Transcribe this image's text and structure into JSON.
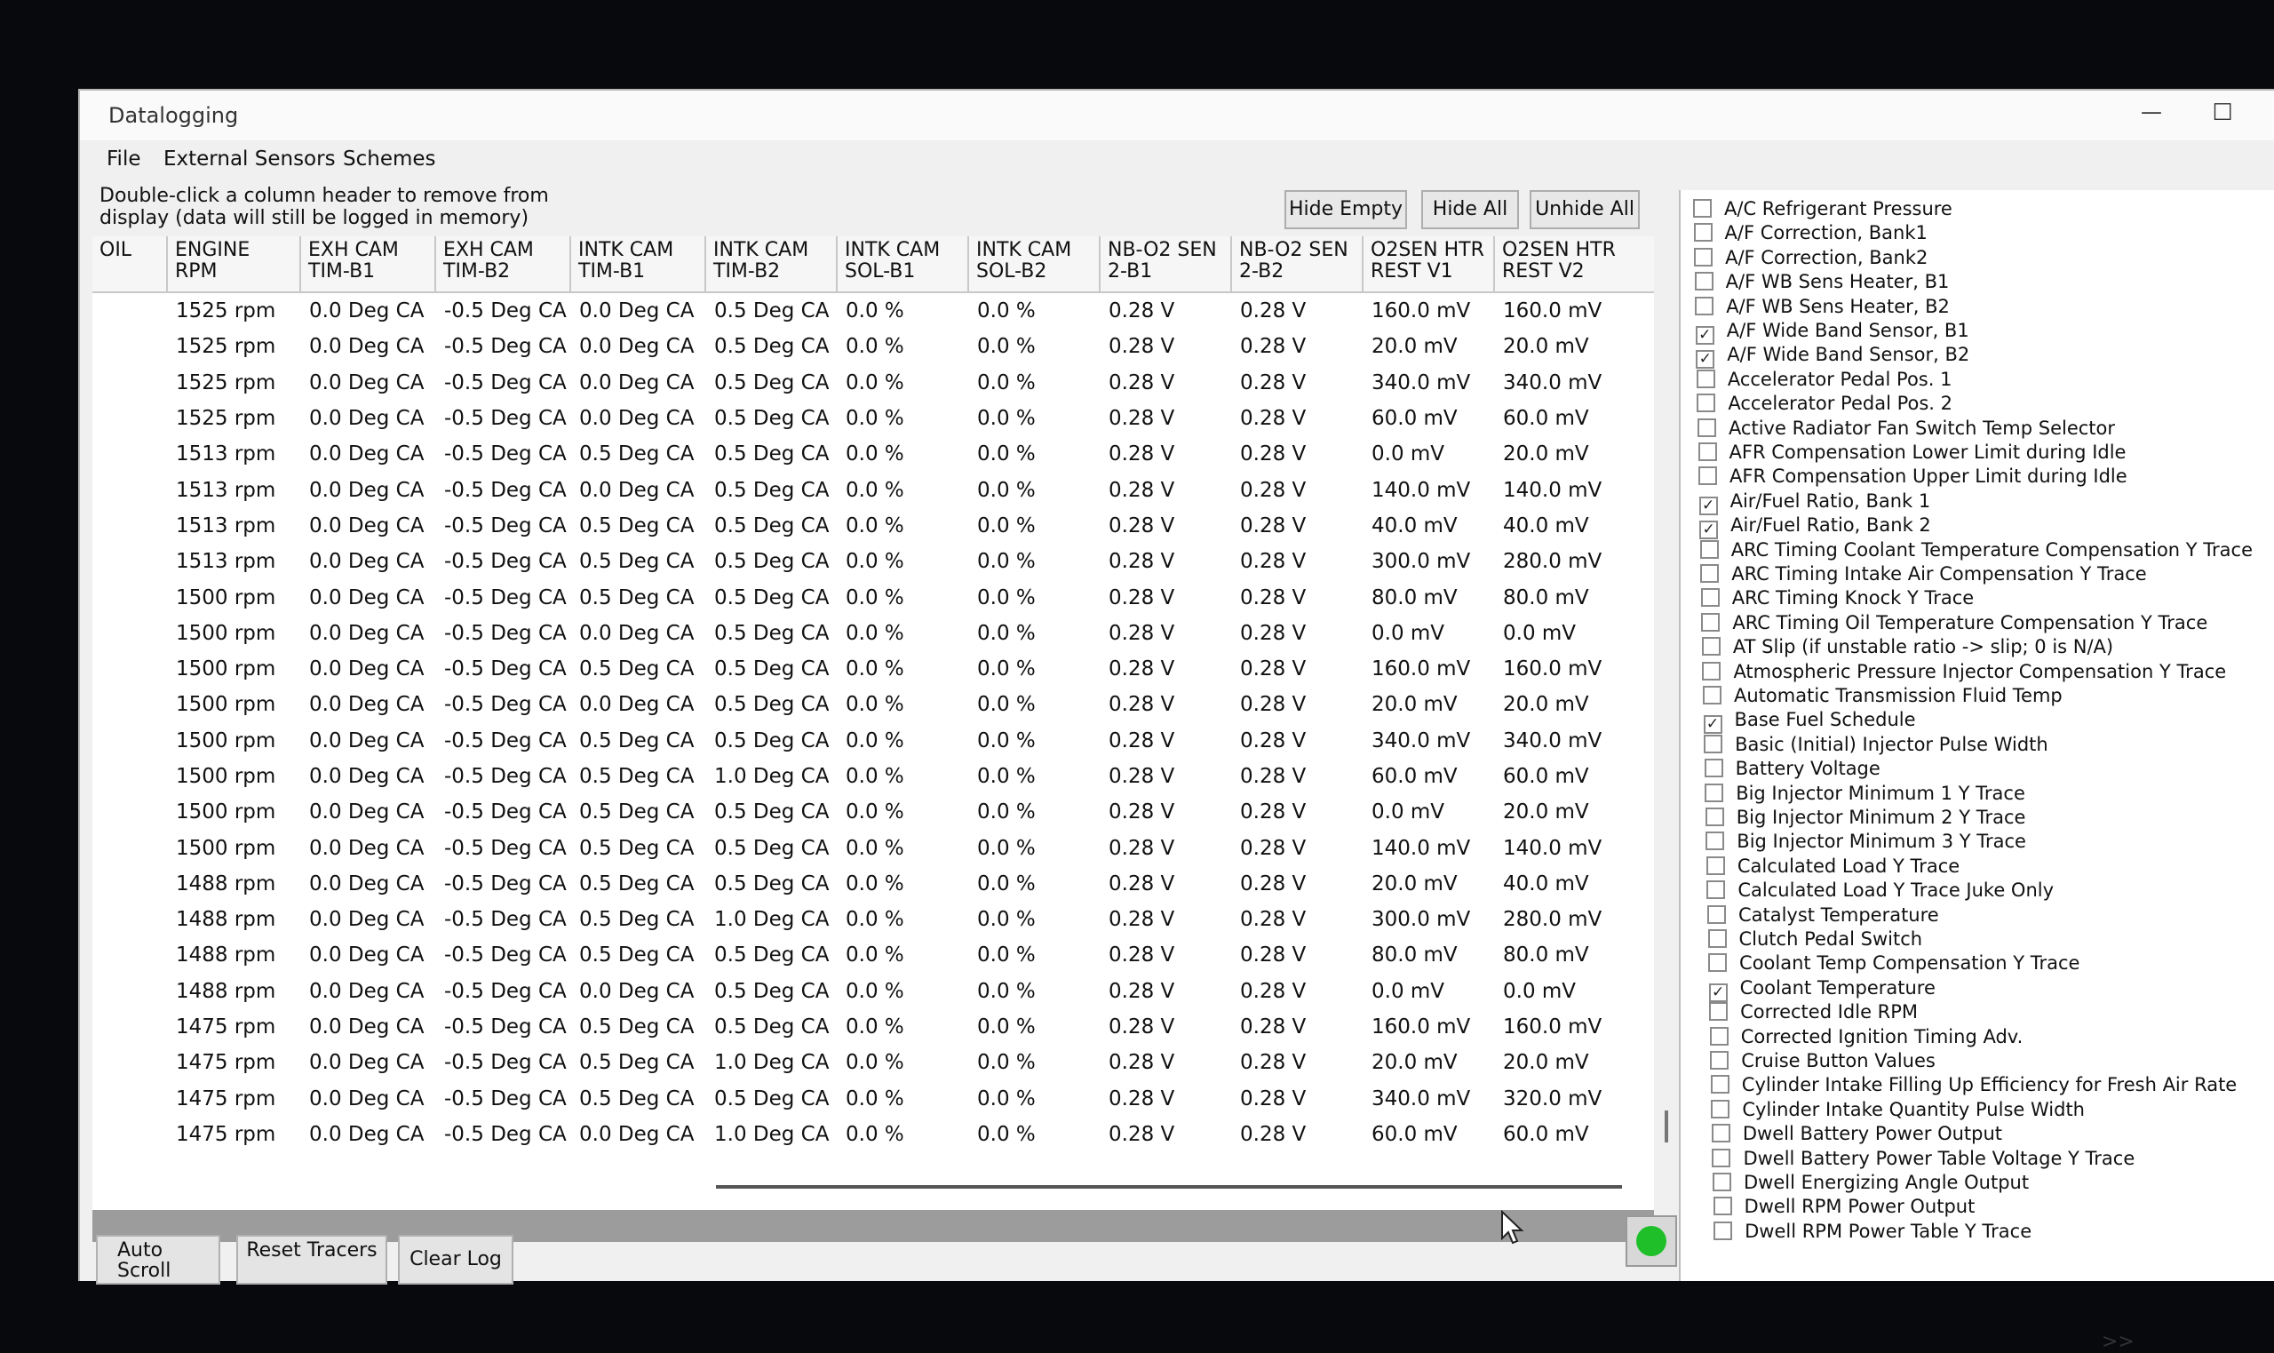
{
  "window": {
    "title": "Datalogging",
    "minimize": "—",
    "maximize": "☐"
  },
  "menu": [
    "File",
    "External Sensors",
    "Schemes"
  ],
  "hint": "Double-click a column header to remove from display (data will still be logged in memory)",
  "buttons": {
    "hide_empty": "Hide Empty",
    "hide_all": "Hide All",
    "unhide_all": "Unhide All",
    "auto_scroll": "Auto Scroll",
    "reset_tracers": "Reset Tracers",
    "clear_log": "Clear Log",
    "more": ">>"
  },
  "columns": [
    "OIL",
    "ENGINE\nRPM",
    "EXH CAM\nTIM-B1",
    "EXH CAM\nTIM-B2",
    "INTK CAM\nTIM-B1",
    "INTK CAM\nTIM-B2",
    "INTK CAM\nSOL-B1",
    "INTK CAM\nSOL-B2",
    "NB-O2 SEN\n2-B1",
    "NB-O2 SEN\n2-B2",
    "O2SEN HTR\nREST V1",
    "O2SEN HTR\nREST V2"
  ],
  "rows": [
    [
      "",
      "1525 rpm",
      "0.0 Deg CA",
      "-0.5 Deg CA",
      "0.0 Deg CA",
      "0.5 Deg CA",
      "0.0 %",
      "0.0 %",
      "0.28 V",
      "0.28 V",
      "160.0 mV",
      "160.0 mV"
    ],
    [
      "",
      "1525 rpm",
      "0.0 Deg CA",
      "-0.5 Deg CA",
      "0.0 Deg CA",
      "0.5 Deg CA",
      "0.0 %",
      "0.0 %",
      "0.28 V",
      "0.28 V",
      "20.0 mV",
      "20.0 mV"
    ],
    [
      "",
      "1525 rpm",
      "0.0 Deg CA",
      "-0.5 Deg CA",
      "0.0 Deg CA",
      "0.5 Deg CA",
      "0.0 %",
      "0.0 %",
      "0.28 V",
      "0.28 V",
      "340.0 mV",
      "340.0 mV"
    ],
    [
      "",
      "1525 rpm",
      "0.0 Deg CA",
      "-0.5 Deg CA",
      "0.0 Deg CA",
      "0.5 Deg CA",
      "0.0 %",
      "0.0 %",
      "0.28 V",
      "0.28 V",
      "60.0 mV",
      "60.0 mV"
    ],
    [
      "",
      "1513 rpm",
      "0.0 Deg CA",
      "-0.5 Deg CA",
      "0.5 Deg CA",
      "0.5 Deg CA",
      "0.0 %",
      "0.0 %",
      "0.28 V",
      "0.28 V",
      "0.0 mV",
      "20.0 mV"
    ],
    [
      "",
      "1513 rpm",
      "0.0 Deg CA",
      "-0.5 Deg CA",
      "0.0 Deg CA",
      "0.5 Deg CA",
      "0.0 %",
      "0.0 %",
      "0.28 V",
      "0.28 V",
      "140.0 mV",
      "140.0 mV"
    ],
    [
      "",
      "1513 rpm",
      "0.0 Deg CA",
      "-0.5 Deg CA",
      "0.5 Deg CA",
      "0.5 Deg CA",
      "0.0 %",
      "0.0 %",
      "0.28 V",
      "0.28 V",
      "40.0 mV",
      "40.0 mV"
    ],
    [
      "",
      "1513 rpm",
      "0.0 Deg CA",
      "-0.5 Deg CA",
      "0.5 Deg CA",
      "0.5 Deg CA",
      "0.0 %",
      "0.0 %",
      "0.28 V",
      "0.28 V",
      "300.0 mV",
      "280.0 mV"
    ],
    [
      "",
      "1500 rpm",
      "0.0 Deg CA",
      "-0.5 Deg CA",
      "0.5 Deg CA",
      "0.5 Deg CA",
      "0.0 %",
      "0.0 %",
      "0.28 V",
      "0.28 V",
      "80.0 mV",
      "80.0 mV"
    ],
    [
      "",
      "1500 rpm",
      "0.0 Deg CA",
      "-0.5 Deg CA",
      "0.0 Deg CA",
      "0.5 Deg CA",
      "0.0 %",
      "0.0 %",
      "0.28 V",
      "0.28 V",
      "0.0 mV",
      "0.0 mV"
    ],
    [
      "",
      "1500 rpm",
      "0.0 Deg CA",
      "-0.5 Deg CA",
      "0.5 Deg CA",
      "0.5 Deg CA",
      "0.0 %",
      "0.0 %",
      "0.28 V",
      "0.28 V",
      "160.0 mV",
      "160.0 mV"
    ],
    [
      "",
      "1500 rpm",
      "0.0 Deg CA",
      "-0.5 Deg CA",
      "0.0 Deg CA",
      "0.5 Deg CA",
      "0.0 %",
      "0.0 %",
      "0.28 V",
      "0.28 V",
      "20.0 mV",
      "20.0 mV"
    ],
    [
      "",
      "1500 rpm",
      "0.0 Deg CA",
      "-0.5 Deg CA",
      "0.5 Deg CA",
      "0.5 Deg CA",
      "0.0 %",
      "0.0 %",
      "0.28 V",
      "0.28 V",
      "340.0 mV",
      "340.0 mV"
    ],
    [
      "",
      "1500 rpm",
      "0.0 Deg CA",
      "-0.5 Deg CA",
      "0.5 Deg CA",
      "1.0 Deg CA",
      "0.0 %",
      "0.0 %",
      "0.28 V",
      "0.28 V",
      "60.0 mV",
      "60.0 mV"
    ],
    [
      "",
      "1500 rpm",
      "0.0 Deg CA",
      "-0.5 Deg CA",
      "0.5 Deg CA",
      "0.5 Deg CA",
      "0.0 %",
      "0.0 %",
      "0.28 V",
      "0.28 V",
      "0.0 mV",
      "20.0 mV"
    ],
    [
      "",
      "1500 rpm",
      "0.0 Deg CA",
      "-0.5 Deg CA",
      "0.5 Deg CA",
      "0.5 Deg CA",
      "0.0 %",
      "0.0 %",
      "0.28 V",
      "0.28 V",
      "140.0 mV",
      "140.0 mV"
    ],
    [
      "",
      "1488 rpm",
      "0.0 Deg CA",
      "-0.5 Deg CA",
      "0.5 Deg CA",
      "0.5 Deg CA",
      "0.0 %",
      "0.0 %",
      "0.28 V",
      "0.28 V",
      "20.0 mV",
      "40.0 mV"
    ],
    [
      "",
      "1488 rpm",
      "0.0 Deg CA",
      "-0.5 Deg CA",
      "0.5 Deg CA",
      "1.0 Deg CA",
      "0.0 %",
      "0.0 %",
      "0.28 V",
      "0.28 V",
      "300.0 mV",
      "280.0 mV"
    ],
    [
      "",
      "1488 rpm",
      "0.0 Deg CA",
      "-0.5 Deg CA",
      "0.5 Deg CA",
      "0.5 Deg CA",
      "0.0 %",
      "0.0 %",
      "0.28 V",
      "0.28 V",
      "80.0 mV",
      "80.0 mV"
    ],
    [
      "",
      "1488 rpm",
      "0.0 Deg CA",
      "-0.5 Deg CA",
      "0.0 Deg CA",
      "0.5 Deg CA",
      "0.0 %",
      "0.0 %",
      "0.28 V",
      "0.28 V",
      "0.0 mV",
      "0.0 mV"
    ],
    [
      "",
      "1475 rpm",
      "0.0 Deg CA",
      "-0.5 Deg CA",
      "0.5 Deg CA",
      "0.5 Deg CA",
      "0.0 %",
      "0.0 %",
      "0.28 V",
      "0.28 V",
      "160.0 mV",
      "160.0 mV"
    ],
    [
      "",
      "1475 rpm",
      "0.0 Deg CA",
      "-0.5 Deg CA",
      "0.5 Deg CA",
      "1.0 Deg CA",
      "0.0 %",
      "0.0 %",
      "0.28 V",
      "0.28 V",
      "20.0 mV",
      "20.0 mV"
    ],
    [
      "",
      "1475 rpm",
      "0.0 Deg CA",
      "-0.5 Deg CA",
      "0.5 Deg CA",
      "0.5 Deg CA",
      "0.0 %",
      "0.0 %",
      "0.28 V",
      "0.28 V",
      "340.0 mV",
      "320.0 mV"
    ],
    [
      "",
      "1475 rpm",
      "0.0 Deg CA",
      "-0.5 Deg CA",
      "0.0 Deg CA",
      "1.0 Deg CA",
      "0.0 %",
      "0.0 %",
      "0.28 V",
      "0.28 V",
      "60.0 mV",
      "60.0 mV"
    ]
  ],
  "sensors": [
    {
      "label": "A/C Refrigerant Pressure",
      "checked": false
    },
    {
      "label": "A/F Correction, Bank1",
      "checked": false
    },
    {
      "label": "A/F Correction, Bank2",
      "checked": false
    },
    {
      "label": "A/F WB Sens Heater, B1",
      "checked": false
    },
    {
      "label": "A/F WB Sens Heater, B2",
      "checked": false
    },
    {
      "label": "A/F Wide Band Sensor, B1",
      "checked": true
    },
    {
      "label": "A/F Wide Band Sensor, B2",
      "checked": true
    },
    {
      "label": "Accelerator Pedal Pos. 1",
      "checked": false
    },
    {
      "label": "Accelerator Pedal Pos. 2",
      "checked": false
    },
    {
      "label": "Active Radiator Fan Switch Temp Selector",
      "checked": false
    },
    {
      "label": "AFR Compensation Lower Limit during Idle",
      "checked": false
    },
    {
      "label": "AFR Compensation Upper Limit during Idle",
      "checked": false
    },
    {
      "label": "Air/Fuel Ratio, Bank 1",
      "checked": true
    },
    {
      "label": "Air/Fuel Ratio, Bank 2",
      "checked": true
    },
    {
      "label": "ARC Timing Coolant Temperature Compensation Y Trace",
      "checked": false
    },
    {
      "label": "ARC Timing Intake Air Compensation Y Trace",
      "checked": false
    },
    {
      "label": "ARC Timing Knock Y Trace",
      "checked": false
    },
    {
      "label": "ARC Timing Oil Temperature Compensation Y Trace",
      "checked": false
    },
    {
      "label": "AT Slip (if unstable ratio -> slip; 0 is N/A)",
      "checked": false
    },
    {
      "label": "Atmospheric Pressure Injector Compensation Y Trace",
      "checked": false
    },
    {
      "label": "Automatic Transmission Fluid Temp",
      "checked": false
    },
    {
      "label": "Base Fuel Schedule",
      "checked": true
    },
    {
      "label": "Basic (Initial) Injector Pulse Width",
      "checked": false
    },
    {
      "label": "Battery Voltage",
      "checked": false
    },
    {
      "label": "Big Injector Minimum 1 Y Trace",
      "checked": false
    },
    {
      "label": "Big Injector Minimum 2 Y Trace",
      "checked": false
    },
    {
      "label": "Big Injector Minimum 3 Y Trace",
      "checked": false
    },
    {
      "label": "Calculated Load Y Trace",
      "checked": false
    },
    {
      "label": "Calculated Load Y Trace Juke Only",
      "checked": false
    },
    {
      "label": "Catalyst Temperature",
      "checked": false
    },
    {
      "label": "Clutch Pedal Switch",
      "checked": false
    },
    {
      "label": "Coolant Temp Compensation Y Trace",
      "checked": false
    },
    {
      "label": "Coolant Temperature",
      "checked": true
    },
    {
      "label": "Corrected Idle RPM",
      "checked": false
    },
    {
      "label": "Corrected Ignition Timing Adv.",
      "checked": false
    },
    {
      "label": "Cruise Button Values",
      "checked": false
    },
    {
      "label": "Cylinder Intake Filling Up Efficiency for Fresh Air Rate",
      "checked": false
    },
    {
      "label": "Cylinder Intake Quantity Pulse Width",
      "checked": false
    },
    {
      "label": "Dwell Battery Power Output",
      "checked": false
    },
    {
      "label": "Dwell Battery Power Table Voltage Y Trace",
      "checked": false
    },
    {
      "label": "Dwell Energizing Angle Output",
      "checked": false
    },
    {
      "label": "Dwell RPM Power Output",
      "checked": false
    },
    {
      "label": "Dwell RPM Power Table Y Trace",
      "checked": false
    }
  ],
  "status_color": "#1fbf2a"
}
